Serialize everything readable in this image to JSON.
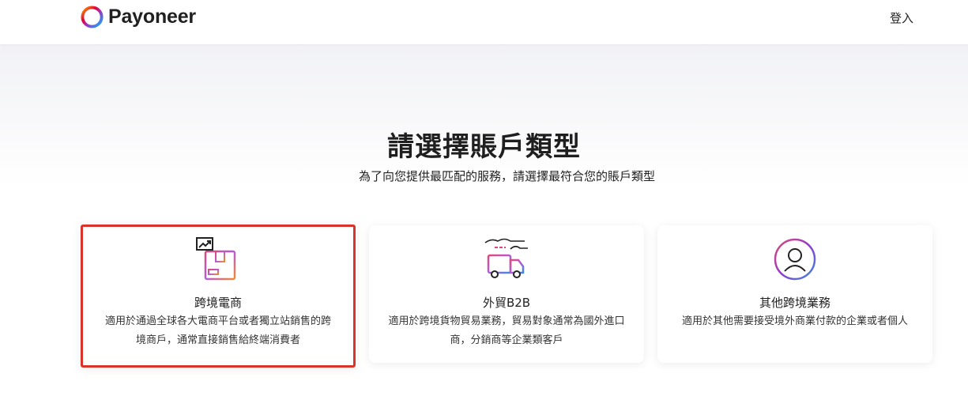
{
  "header": {
    "brand": "Payoneer",
    "login_label": "登入"
  },
  "main": {
    "title": "請選擇賬戶類型",
    "subtitle": "為了向您提供最匹配的服務，請選擇最符合您的賬戶類型"
  },
  "cards": [
    {
      "name": "跨境電商",
      "description": "適用於通過全球各大電商平台或者獨立站銷售的跨境商戶，通常直接銷售給終端消費者",
      "icon": "ecommerce-box-icon",
      "selected": true
    },
    {
      "name": "外貿B2B",
      "description": "適用於跨境貨物貿易業務，貿易對象通常為國外進口商，分銷商等企業類客戶",
      "icon": "delivery-truck-icon",
      "selected": false
    },
    {
      "name": "其他跨境業務",
      "description": "適用於其他需要接受境外商業付款的企業或者個人",
      "icon": "user-avatar-icon",
      "selected": false
    }
  ],
  "colors": {
    "selected_border": "#d9342b",
    "logo_gradient": [
      "#f7a600",
      "#e4003a",
      "#8e3ec7",
      "#3b8ae6",
      "#2fb5a1"
    ]
  }
}
